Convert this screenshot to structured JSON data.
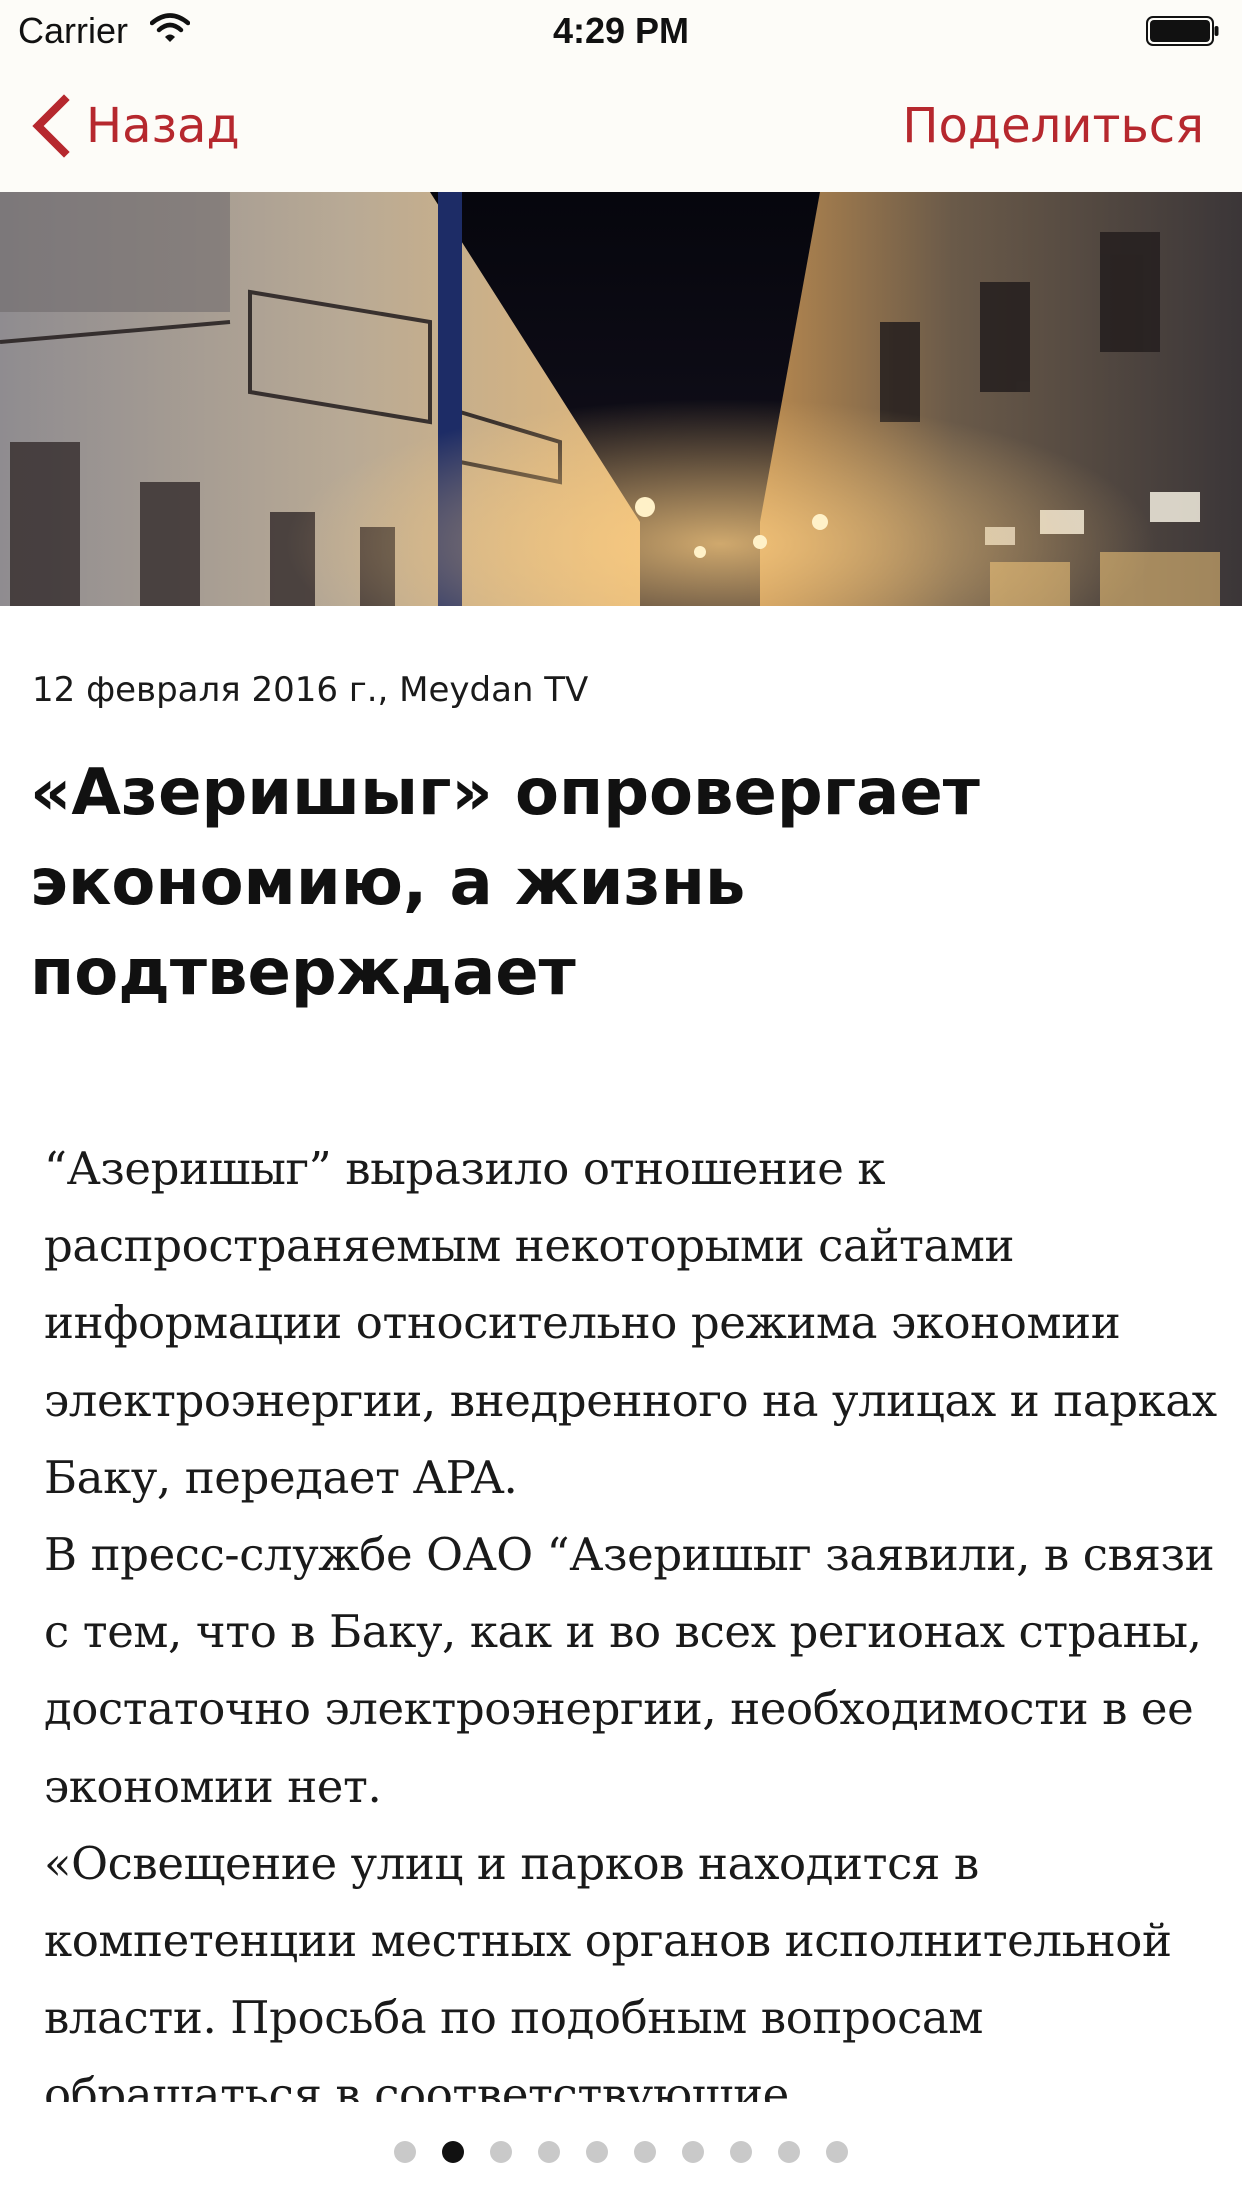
{
  "status_bar": {
    "carrier": "Carrier",
    "time": "4:29 PM",
    "wifi_icon": "wifi-icon",
    "battery_icon": "battery-icon"
  },
  "nav": {
    "back_label": "Назад",
    "back_icon": "chevron-left-icon",
    "share_label": "Поделиться",
    "accent_color": "#b6282e"
  },
  "hero": {
    "image": "night-street-photo"
  },
  "article": {
    "meta": "12 февраля 2016 г., Meydan TV",
    "title": "«Азеришыг» опровергает экономию, а жизнь подтверждает",
    "paragraphs": [
      "“Азеришыг” выразило отношение к распространяемым некоторыми сайтами информации относительно режима экономии электроэнергии, внедренного на улицах и парках Баку, передает APA.",
      "В пресс-службе ОАО “Азеришыг заявили, в связи с тем, что в Баку, как и во всех регионах страны, достаточно электроэнергии, необходимости в ее экономии нет.",
      "«Освещение улиц и парков находится в компетенции местных органов исполнительной власти. Просьба по подобным вопросам обращаться в соответствующие"
    ]
  },
  "pager": {
    "total": 10,
    "current_index": 1
  }
}
